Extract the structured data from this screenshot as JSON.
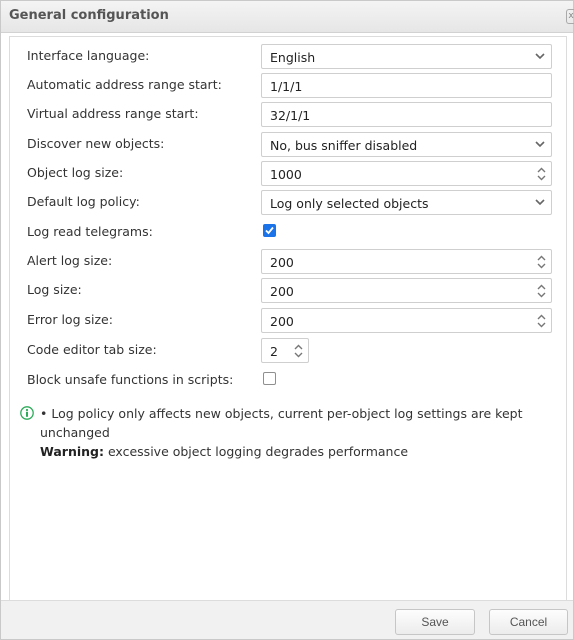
{
  "dialog": {
    "title": "General configuration",
    "close_label": "x"
  },
  "fields": {
    "interface_language": {
      "label": "Interface language:",
      "value": "English"
    },
    "auto_address_start": {
      "label": "Automatic address range start:",
      "value": "1/1/1"
    },
    "virtual_address_start": {
      "label": "Virtual address range start:",
      "value": "32/1/1"
    },
    "discover_new_objects": {
      "label": "Discover new objects:",
      "value": "No, bus sniffer disabled"
    },
    "object_log_size": {
      "label": "Object log size:",
      "value": "1000"
    },
    "default_log_policy": {
      "label": "Default log policy:",
      "value": "Log only selected objects"
    },
    "log_read_telegrams": {
      "label": "Log read telegrams:",
      "checked": true
    },
    "alert_log_size": {
      "label": "Alert log size:",
      "value": "200"
    },
    "log_size": {
      "label": "Log size:",
      "value": "200"
    },
    "error_log_size": {
      "label": "Error log size:",
      "value": "200"
    },
    "code_editor_tab_size": {
      "label": "Code editor tab size:",
      "value": "2"
    },
    "block_unsafe_functions": {
      "label": "Block unsafe functions in scripts:",
      "checked": false
    }
  },
  "info": {
    "icon": "info-icon",
    "line1": "• Log policy only affects new objects, current per-object log settings are kept",
    "line2": "unchanged",
    "warning_label": "Warning:",
    "warning_text": " excessive object logging degrades performance"
  },
  "footer": {
    "save_label": "Save",
    "cancel_label": "Cancel"
  },
  "colors": {
    "checkbox_accent": "#1a73e8",
    "info_icon": "#2eab5a"
  }
}
